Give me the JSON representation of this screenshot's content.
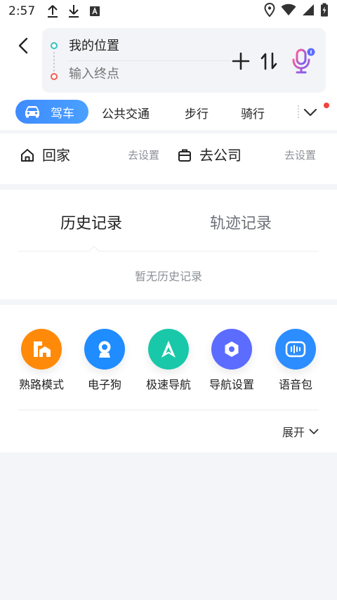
{
  "status_bar": {
    "time": "2:57"
  },
  "route": {
    "start_label": "我的位置",
    "end_placeholder": "输入终点"
  },
  "tabs": {
    "active": "驾车",
    "items": [
      "公共交通",
      "步行",
      "骑行"
    ]
  },
  "places": {
    "home_label": "回家",
    "home_action": "去设置",
    "company_label": "去公司",
    "company_action": "去设置"
  },
  "history": {
    "tab_history": "历史记录",
    "tab_track": "轨迹记录",
    "empty_text": "暂无历史记录"
  },
  "tools": {
    "items": [
      {
        "label": "熟路模式",
        "icon": "familiar-route-icon",
        "color": "#ff8a0a"
      },
      {
        "label": "电子狗",
        "icon": "camera-icon",
        "color": "#1f8cff"
      },
      {
        "label": "极速导航",
        "icon": "arrow-nav-icon",
        "color": "#19c8a8"
      },
      {
        "label": "导航设置",
        "icon": "gear-icon",
        "color": "#5b6cff"
      },
      {
        "label": "语音包",
        "icon": "voice-pack-icon",
        "color": "#2b8dff"
      }
    ],
    "expand_label": "展开"
  },
  "colors": {
    "accent_blue": "#3e8bff",
    "notification_red": "#f2423d"
  }
}
